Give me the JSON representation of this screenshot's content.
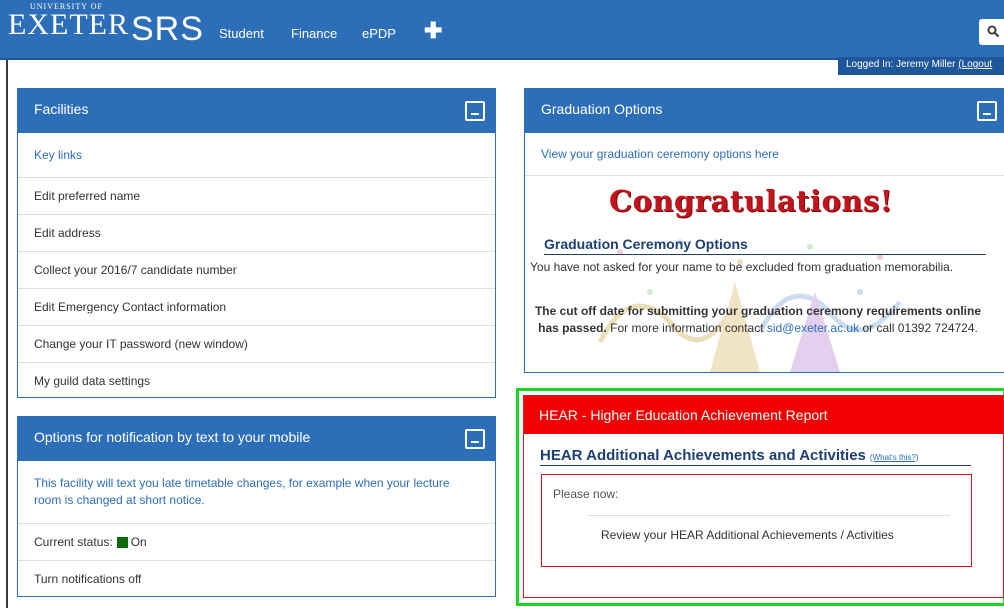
{
  "header": {
    "logo_univ": "UNIVERSITY OF",
    "logo_exeter": "EXETER",
    "brand": "SRS",
    "nav": [
      "Student",
      "Finance",
      "ePDP"
    ],
    "plus_icon": "plus-icon",
    "search_icon": "search-icon",
    "logged_in_text": "Logged In: Jeremy Miller",
    "logout_label": "(Logout"
  },
  "facilities": {
    "title": "Facilities",
    "items": [
      "Key links",
      "Edit preferred name",
      "Edit address",
      "Collect your 2016/7 candidate number",
      "Edit Emergency Contact information",
      "Change your IT password (new window)",
      "My guild data settings"
    ]
  },
  "notifications": {
    "title": "Options for notification by text to your mobile",
    "description": "This facility will text you late timetable changes, for example when your lecture room is changed at short notice.",
    "status_label": "Current status:",
    "status_value": "On",
    "toggle_label": "Turn notifications off"
  },
  "graduation": {
    "title": "Graduation Options",
    "link_text": "View your graduation ceremony options here",
    "banner": "Congratulations!",
    "section_title": "Graduation Ceremony Options",
    "exclusion_text": "You have not asked for your name to be excluded from graduation memorabilia.",
    "cutoff_bold": "The cut off date for submitting your graduation ceremony requirements online has passed.",
    "cutoff_rest": " For more information contact ",
    "contact_email": "sid@exeter.ac.uk",
    "cutoff_tail": " or call 01392 724724."
  },
  "hear": {
    "title": "HEAR - Higher Education Achievement Report",
    "subtitle": "HEAR Additional Achievements and Activities",
    "whats_this": "(What's this?)",
    "please_now": "Please now:",
    "review_text": "Review your HEAR Additional Achievements / Activities"
  },
  "colors": {
    "brand_blue": "#2c6eb8",
    "hear_red": "#f00000",
    "highlight_green": "#22d322",
    "status_green": "#0a6b0a"
  }
}
